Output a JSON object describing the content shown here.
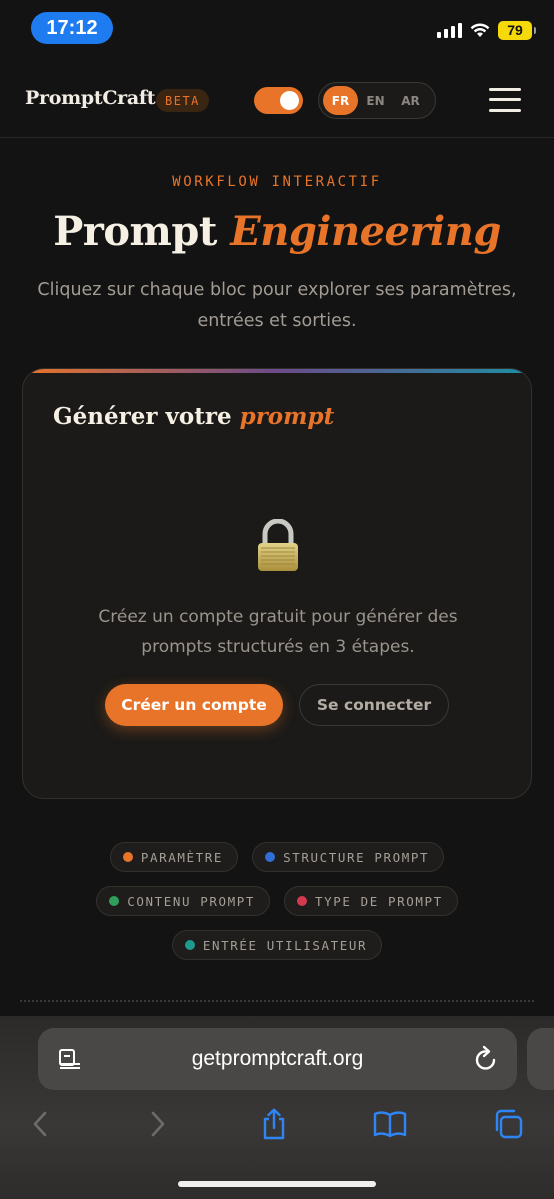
{
  "status_bar": {
    "time": "17:12",
    "battery": "79"
  },
  "nav": {
    "logo": "PromptCraft",
    "badge": "BETA",
    "languages": [
      {
        "label": "FR",
        "active": true
      },
      {
        "label": "EN",
        "active": false
      },
      {
        "label": "AR",
        "active": false
      }
    ]
  },
  "hero": {
    "eyebrow": "WORKFLOW INTERACTIF",
    "title_plain": "Prompt",
    "title_accent": "Engineering",
    "subtitle": "Cliquez sur chaque bloc pour explorer ses paramètres, entrées et sorties."
  },
  "card": {
    "title_plain": "Générer votre",
    "title_accent": "prompt",
    "message": "Créez un compte gratuit pour générer des prompts structurés en 3 étapes.",
    "primary_label": "Créer un compte",
    "secondary_label": "Se connecter"
  },
  "legend": [
    {
      "label": "PARAMÈTRE",
      "color": "#e8742a"
    },
    {
      "label": "STRUCTURE PROMPT",
      "color": "#2f6fd6"
    },
    {
      "label": "CONTENU PROMPT",
      "color": "#2f9e5a"
    },
    {
      "label": "TYPE DE PROMPT",
      "color": "#d43a4e"
    },
    {
      "label": "ENTRÉE UTILISATEUR",
      "color": "#1f9a8e"
    }
  ],
  "browser": {
    "url": "getpromptcraft.org"
  },
  "colors": {
    "accent": "#e8742a",
    "background": "#141313",
    "system_blue": "#2e86f6"
  },
  "icons": {
    "url_left": "reader-icon",
    "url_right": "reload-icon",
    "toolbar": [
      "back-icon",
      "forward-icon",
      "share-icon",
      "bookmarks-icon",
      "tabs-icon"
    ]
  }
}
